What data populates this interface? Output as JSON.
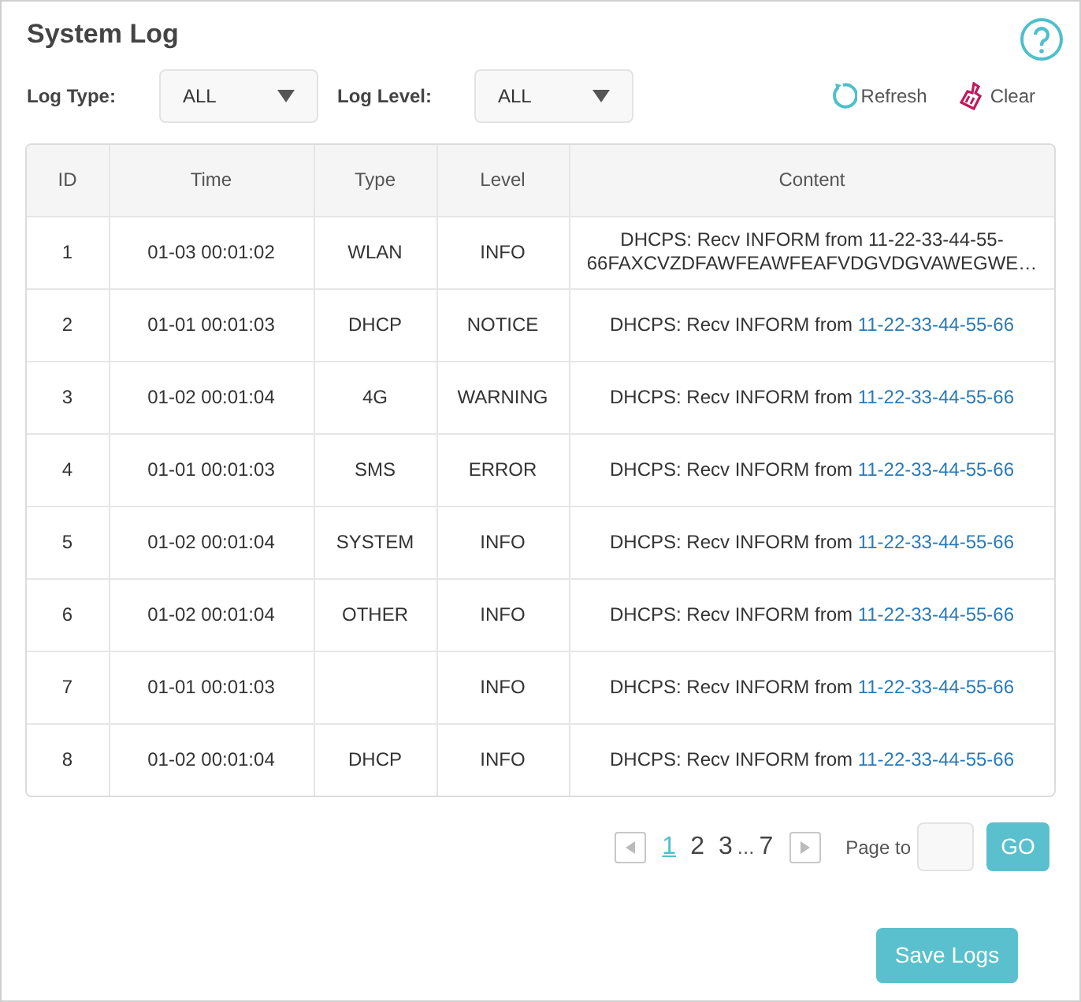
{
  "title": "System Log",
  "filters": [
    {
      "label": "Log Type:",
      "value": "ALL"
    },
    {
      "label": "Log Level:",
      "value": "ALL"
    }
  ],
  "actions": [
    {
      "kind": "refresh",
      "label": "Refresh"
    },
    {
      "kind": "clear",
      "label": "Clear"
    }
  ],
  "table": {
    "columns": [
      "ID",
      "Time",
      "Type",
      "Level",
      "Content"
    ],
    "rows": [
      {
        "id": "1",
        "time": "01-03 00:01:02",
        "type": "WLAN",
        "level": "INFO",
        "content": "DHCPS: Recv INFORM from 11-22-33-44-55-66FAXCVZDFAWFEAWFEAFVDGVDGVAWEGWE…"
      },
      {
        "id": "2",
        "time": "01-01 00:01:03",
        "type": "DHCP",
        "level": "NOTICE",
        "content": "DHCPS: Recv INFORM from ",
        "address": "11-22-33-44-55-66"
      },
      {
        "id": "3",
        "time": "01-02 00:01:04",
        "type": "4G",
        "level": "WARNING",
        "content": "DHCPS: Recv INFORM from ",
        "address": "11-22-33-44-55-66"
      },
      {
        "id": "4",
        "time": "01-01 00:01:03",
        "type": "SMS",
        "level": "ERROR",
        "content": "DHCPS: Recv INFORM from ",
        "address": "11-22-33-44-55-66"
      },
      {
        "id": "5",
        "time": "01-02 00:01:04",
        "type": "SYSTEM",
        "level": "INFO",
        "content": "DHCPS: Recv INFORM from ",
        "address": "11-22-33-44-55-66"
      },
      {
        "id": "6",
        "time": "01-02 00:01:04",
        "type": "OTHER",
        "level": "INFO",
        "content": "DHCPS: Recv INFORM from ",
        "address": "11-22-33-44-55-66"
      },
      {
        "id": "7",
        "time": "01-01 00:01:03",
        "level": "INFO",
        "content": "DHCPS: Recv INFORM from ",
        "address": "11-22-33-44-55-66"
      },
      {
        "id": "8",
        "time": "01-02 00:01:04",
        "type": "DHCP",
        "level": "INFO",
        "content": "DHCPS: Recv INFORM from ",
        "address": "11-22-33-44-55-66"
      }
    ]
  },
  "pagination": {
    "pages": [
      {
        "label": "1",
        "selected": true
      },
      {
        "label": "2",
        "selected": false
      },
      {
        "label": "3",
        "selected": false
      },
      {
        "label": "...",
        "kind": "ellipsis"
      },
      {
        "label": "7",
        "selected": false
      }
    ],
    "page_to_label": "Page to",
    "go_button": "GO"
  },
  "save_button": "Save Logs"
}
